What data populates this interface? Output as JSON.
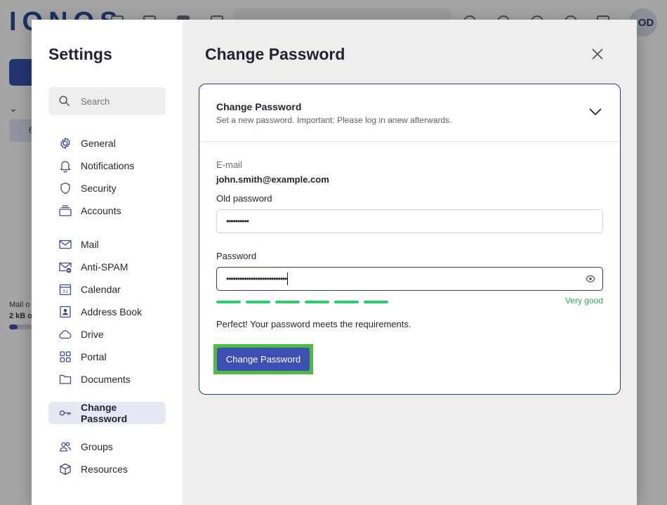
{
  "background_app": {
    "logo": "IONOS",
    "avatar_initials": "OD",
    "mail_label": "Mail o",
    "storage_label": "2 kB o",
    "folder_count": "6"
  },
  "settings": {
    "title": "Settings",
    "search_placeholder": "Search",
    "nav_group_1": [
      {
        "label": "General",
        "icon": "gear-icon"
      },
      {
        "label": "Notifications",
        "icon": "bell-icon"
      },
      {
        "label": "Security",
        "icon": "shield-icon"
      },
      {
        "label": "Accounts",
        "icon": "accounts-stack-icon"
      }
    ],
    "nav_group_2": [
      {
        "label": "Mail",
        "icon": "envelope-icon"
      },
      {
        "label": "Anti-SPAM",
        "icon": "envelope-block-icon"
      },
      {
        "label": "Calendar",
        "icon": "calendar-icon"
      },
      {
        "label": "Address Book",
        "icon": "contact-book-icon"
      },
      {
        "label": "Drive",
        "icon": "cloud-icon"
      },
      {
        "label": "Portal",
        "icon": "grid-icon"
      },
      {
        "label": "Documents",
        "icon": "folder-icon"
      }
    ],
    "nav_active": {
      "label": "Change Password",
      "icon": "key-icon"
    },
    "nav_group_3": [
      {
        "label": "Groups",
        "icon": "users-icon"
      },
      {
        "label": "Resources",
        "icon": "cube-icon"
      }
    ]
  },
  "panel": {
    "title": "Change Password",
    "card_title": "Change Password",
    "card_subtitle": "Set a new password. Important: Please log in anew afterwards.",
    "email_label": "E-mail",
    "email_value": "john.smith@example.com",
    "old_password_label": "Old password",
    "old_password_value": "••••••••••",
    "password_label": "Password",
    "password_value": "•••••••••••••••••••••••••••",
    "strength_label": "Very good",
    "strength_level": "6/6",
    "hint": "Perfect! Your password meets the requirements.",
    "submit_label": "Change Password"
  },
  "colors": {
    "accent": "#3d4fb2",
    "strength": "#2ecc71",
    "highlight": "#4cbb3f",
    "card_border": "#2a3a7c"
  }
}
